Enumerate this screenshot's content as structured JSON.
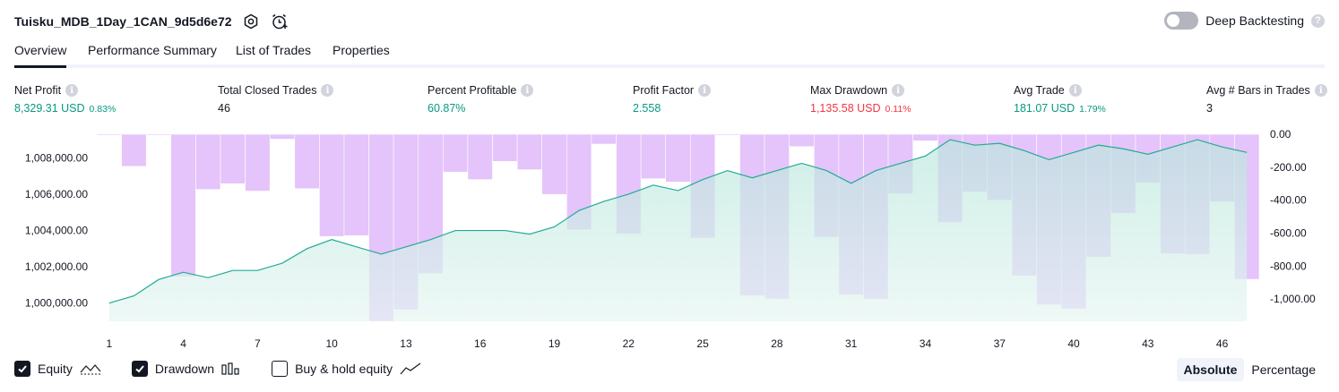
{
  "header": {
    "strategy_name": "Tuisku_MDB_1Day_1CAN_9d5d6e72",
    "settings_icon": "gear-icon",
    "alert_icon": "alarm-clock-plus-icon",
    "deep_backtesting_label": "Deep Backtesting",
    "deep_backtesting_enabled": false
  },
  "tabs": [
    {
      "label": "Overview",
      "active": true
    },
    {
      "label": "Performance Summary",
      "active": false
    },
    {
      "label": "List of Trades",
      "active": false
    },
    {
      "label": "Properties",
      "active": false
    }
  ],
  "metrics": {
    "net_profit": {
      "label": "Net Profit",
      "value": "8,329.31 USD",
      "pct": "0.83%"
    },
    "total_closed_trades": {
      "label": "Total Closed Trades",
      "value": "46"
    },
    "percent_profitable": {
      "label": "Percent Profitable",
      "value": "60.87%"
    },
    "profit_factor": {
      "label": "Profit Factor",
      "value": "2.558"
    },
    "max_drawdown": {
      "label": "Max Drawdown",
      "value": "1,135.58 USD",
      "pct": "0.11%"
    },
    "avg_trade": {
      "label": "Avg Trade",
      "value": "181.07 USD",
      "pct": "1.79%"
    },
    "avg_bars": {
      "label": "Avg # Bars in Trades",
      "value": "3"
    }
  },
  "legend": {
    "equity": {
      "label": "Equity",
      "checked": true
    },
    "drawdown": {
      "label": "Drawdown",
      "checked": true
    },
    "buy_hold": {
      "label": "Buy & hold equity",
      "checked": false
    }
  },
  "scale_toggle": {
    "absolute": "Absolute",
    "percentage": "Percentage",
    "selected": "Absolute"
  },
  "colors": {
    "equity_line": "#22ab94",
    "equity_fill_top": "#b9e6dc",
    "drawdown_bar": "#ce93f6",
    "positive": "#089981",
    "negative": "#f23645"
  },
  "chart_data": {
    "type": "area",
    "x": [
      1,
      2,
      3,
      4,
      5,
      6,
      7,
      8,
      9,
      10,
      11,
      12,
      13,
      14,
      15,
      16,
      17,
      18,
      19,
      20,
      21,
      22,
      23,
      24,
      25,
      26,
      27,
      28,
      29,
      30,
      31,
      32,
      33,
      34,
      35,
      36,
      37,
      38,
      39,
      40,
      41,
      42,
      43,
      44,
      45,
      46,
      47
    ],
    "x_ticks": [
      "1",
      "4",
      "7",
      "10",
      "13",
      "16",
      "19",
      "22",
      "25",
      "28",
      "31",
      "34",
      "37",
      "40",
      "43",
      "46"
    ],
    "left_axis": {
      "ticks": [
        "1,000,000.00",
        "1,002,000.00",
        "1,004,000.00",
        "1,006,000.00",
        "1,008,000.00"
      ],
      "ylim": [
        999000,
        1009300
      ]
    },
    "right_axis": {
      "ticks": [
        "0.00",
        "-200.00",
        "-400.00",
        "-600.00",
        "-800.00",
        "-1,000.00"
      ],
      "ylim": [
        -1135,
        0
      ]
    },
    "series": [
      {
        "name": "Equity",
        "type": "area",
        "values": [
          1000000,
          1000400,
          1001300,
          1001700,
          1001400,
          1001800,
          1001800,
          1002200,
          1003000,
          1003500,
          1003100,
          1002700,
          1003100,
          1003500,
          1004000,
          1004000,
          1004000,
          1003800,
          1004200,
          1005100,
          1005600,
          1006000,
          1006500,
          1006200,
          1006800,
          1007300,
          1006900,
          1007300,
          1007700,
          1007300,
          1006600,
          1007300,
          1007700,
          1008100,
          1009000,
          1008700,
          1008800,
          1008400,
          1007900,
          1008300,
          1008700,
          1008500,
          1008200,
          1008600,
          1009000,
          1008600,
          1008300
        ]
      },
      {
        "name": "Drawdown",
        "type": "bar",
        "values": [
          0,
          -195,
          0,
          -865,
          -335,
          -300,
          -345,
          -30,
          -330,
          -620,
          -615,
          -1135,
          -1065,
          -845,
          -230,
          -275,
          -165,
          -215,
          -365,
          -580,
          -60,
          -605,
          -270,
          -290,
          -630,
          0,
          -980,
          -1000,
          -75,
          -625,
          -975,
          -1000,
          -360,
          -40,
          -535,
          -350,
          -400,
          -860,
          -1035,
          -1060,
          -745,
          -480,
          -295,
          -725,
          -730,
          -410,
          -880
        ]
      }
    ],
    "grid": false,
    "legend_position": "bottom-left"
  }
}
